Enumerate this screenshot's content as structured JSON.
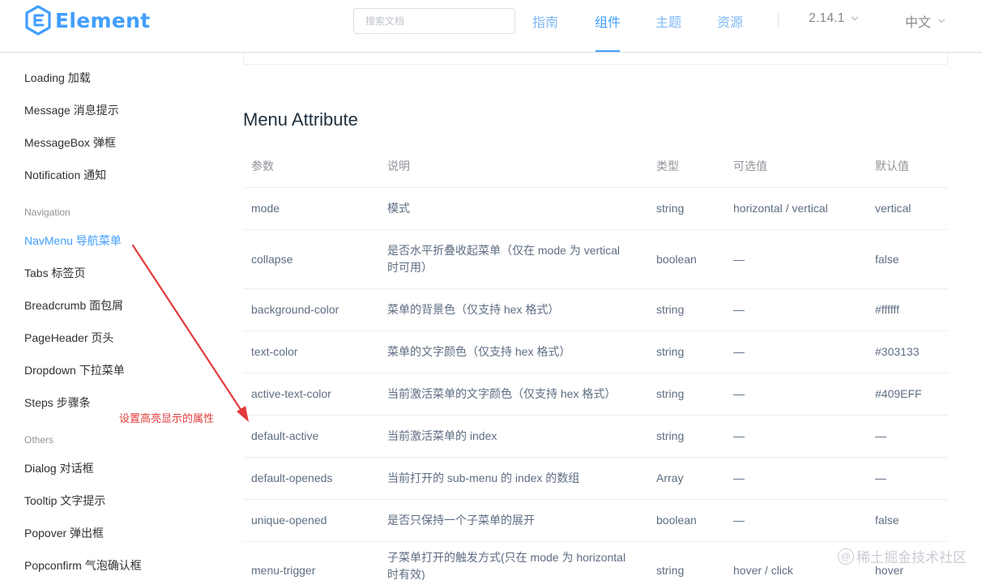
{
  "header": {
    "logo_text": "Element",
    "search_placeholder": "搜索文档",
    "nav": [
      {
        "label": "指南",
        "active": false
      },
      {
        "label": "组件",
        "active": true
      },
      {
        "label": "主题",
        "active": false
      },
      {
        "label": "资源",
        "active": false
      }
    ],
    "version": "2.14.1",
    "language": "中文",
    "accent_color": "#409EFF"
  },
  "sidebar": {
    "items_top": [
      {
        "label": "Loading 加载"
      },
      {
        "label": "Message 消息提示"
      },
      {
        "label": "MessageBox 弹框"
      },
      {
        "label": "Notification 通知"
      }
    ],
    "group_navigation": "Navigation",
    "items_navigation": [
      {
        "label": "NavMenu 导航菜单",
        "active": true
      },
      {
        "label": "Tabs 标签页"
      },
      {
        "label": "Breadcrumb 面包屑"
      },
      {
        "label": "PageHeader 页头"
      },
      {
        "label": "Dropdown 下拉菜单"
      },
      {
        "label": "Steps 步骤条"
      }
    ],
    "group_others": "Others",
    "items_others": [
      {
        "label": "Dialog 对话框"
      },
      {
        "label": "Tooltip 文字提示"
      },
      {
        "label": "Popover 弹出框"
      },
      {
        "label": "Popconfirm 气泡确认框"
      }
    ]
  },
  "main": {
    "section_title": "Menu Attribute",
    "table": {
      "headers": [
        "参数",
        "说明",
        "类型",
        "可选值",
        "默认值"
      ],
      "rows": [
        [
          "mode",
          "模式",
          "string",
          "horizontal / vertical",
          "vertical"
        ],
        [
          "collapse",
          "是否水平折叠收起菜单（仅在 mode 为 vertical 时可用）",
          "boolean",
          "—",
          "false"
        ],
        [
          "background-color",
          "菜单的背景色（仅支持 hex 格式）",
          "string",
          "—",
          "#ffffff"
        ],
        [
          "text-color",
          "菜单的文字颜色（仅支持 hex 格式）",
          "string",
          "—",
          "#303133"
        ],
        [
          "active-text-color",
          "当前激活菜单的文字颜色（仅支持 hex 格式）",
          "string",
          "—",
          "#409EFF"
        ],
        [
          "default-active",
          "当前激活菜单的 index",
          "string",
          "—",
          "—"
        ],
        [
          "default-openeds",
          "当前打开的 sub-menu 的 index 的数组",
          "Array",
          "—",
          "—"
        ],
        [
          "unique-opened",
          "是否只保持一个子菜单的展开",
          "boolean",
          "—",
          "false"
        ],
        [
          "menu-trigger",
          "子菜单打开的触发方式(只在 mode 为 horizontal 时有效)",
          "string",
          "hover / click",
          "hover"
        ]
      ]
    }
  },
  "annotation": {
    "text": "设置高亮显示的属性",
    "color": "#e23a3a"
  },
  "watermark": "稀土掘金技术社区"
}
